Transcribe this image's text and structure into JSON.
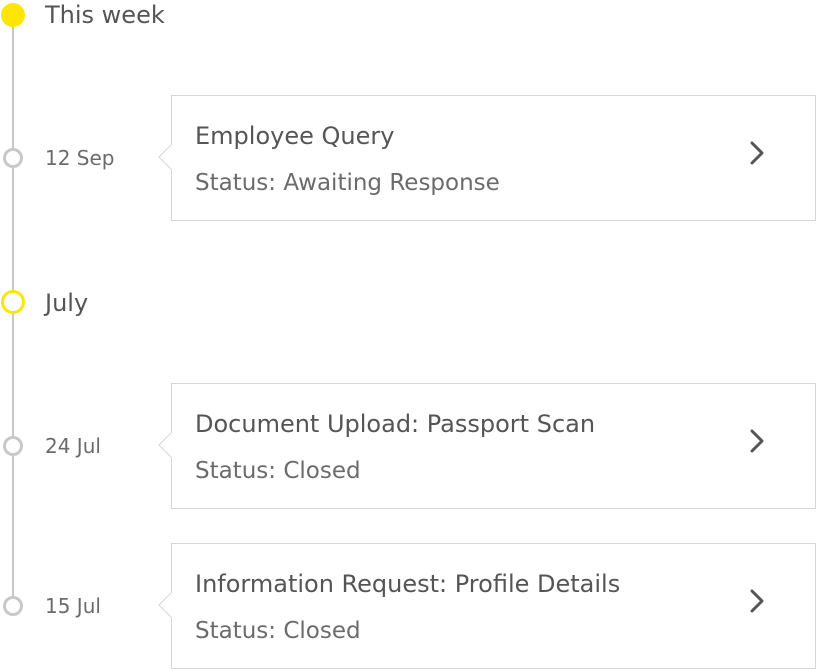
{
  "timeline": {
    "sections": [
      {
        "label": "This week",
        "entries": [
          {
            "date": "12 Sep",
            "title": "Employee Query",
            "status": "Status: Awaiting Response",
            "chevron_icon": "chevron-right-icon"
          }
        ]
      },
      {
        "label": "July",
        "entries": [
          {
            "date": "24 Jul",
            "title": "Document Upload: Passport Scan",
            "status": "Status: Closed",
            "chevron_icon": "chevron-right-icon"
          },
          {
            "date": "15 Jul",
            "title": "Information Request: Profile Details",
            "status": "Status: Closed",
            "chevron_icon": "chevron-right-icon"
          }
        ]
      }
    ]
  },
  "colors": {
    "accent": "#ffe600",
    "line": "#c8c8c8",
    "text": "#555555"
  }
}
